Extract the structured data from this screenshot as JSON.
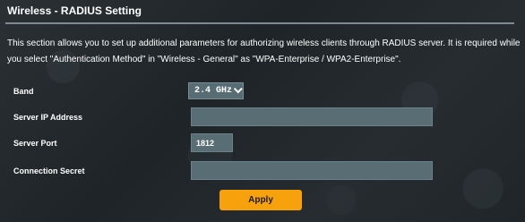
{
  "page": {
    "title": "Wireless - RADIUS Setting",
    "description": "This section allows you to set up additional parameters for authorizing wireless clients through RADIUS server. It is required while you select \"Authentication Method\" in \"Wireless - General\" as \"WPA-Enterprise / WPA2-Enterprise\"."
  },
  "form": {
    "band": {
      "label": "Band",
      "value": "2.4 GHz"
    },
    "server_ip": {
      "label": "Server IP Address",
      "value": "",
      "placeholder": ""
    },
    "server_port": {
      "label": "Server Port",
      "value": "1812"
    },
    "connection_secret": {
      "label": "Connection Secret",
      "value": "",
      "placeholder": ""
    },
    "apply_label": "Apply"
  },
  "colors": {
    "accent": "#f7a10c",
    "field_bg": "#596e74",
    "background": "#1c2124"
  },
  "icons": {
    "band_dropdown": "chevron-down-icon"
  }
}
